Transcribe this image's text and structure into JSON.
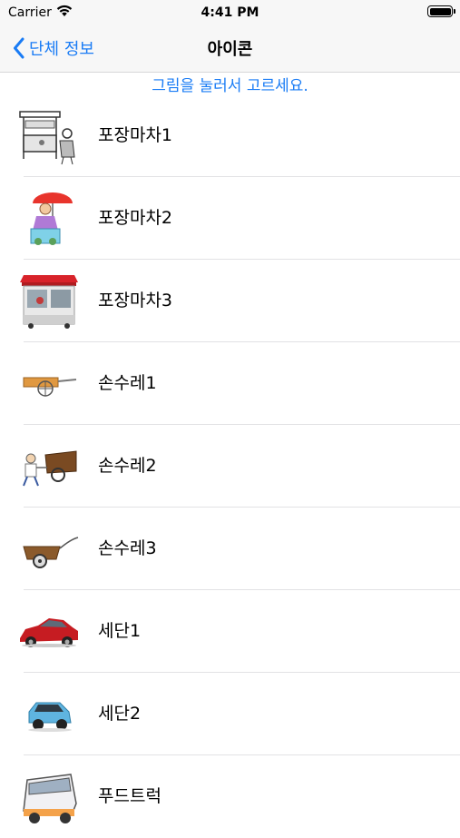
{
  "status_bar": {
    "carrier": "Carrier",
    "time": "4:41 PM"
  },
  "nav": {
    "back_label": "단체 정보",
    "title": "아이콘"
  },
  "instruction": "그림을 눌러서 고르세요.",
  "items": [
    {
      "label": "포장마차1",
      "icon": "street-stall-sketch-icon"
    },
    {
      "label": "포장마차2",
      "icon": "umbrella-vendor-icon"
    },
    {
      "label": "포장마차3",
      "icon": "red-roof-kiosk-icon"
    },
    {
      "label": "손수레1",
      "icon": "handcart-icon"
    },
    {
      "label": "손수레2",
      "icon": "person-pulling-cart-icon"
    },
    {
      "label": "손수레3",
      "icon": "wooden-cart-icon"
    },
    {
      "label": "세단1",
      "icon": "red-sedan-icon"
    },
    {
      "label": "세단2",
      "icon": "blue-compact-car-icon"
    },
    {
      "label": "푸드트럭",
      "icon": "food-truck-icon"
    }
  ],
  "colors": {
    "accent": "#1a7cf5"
  }
}
